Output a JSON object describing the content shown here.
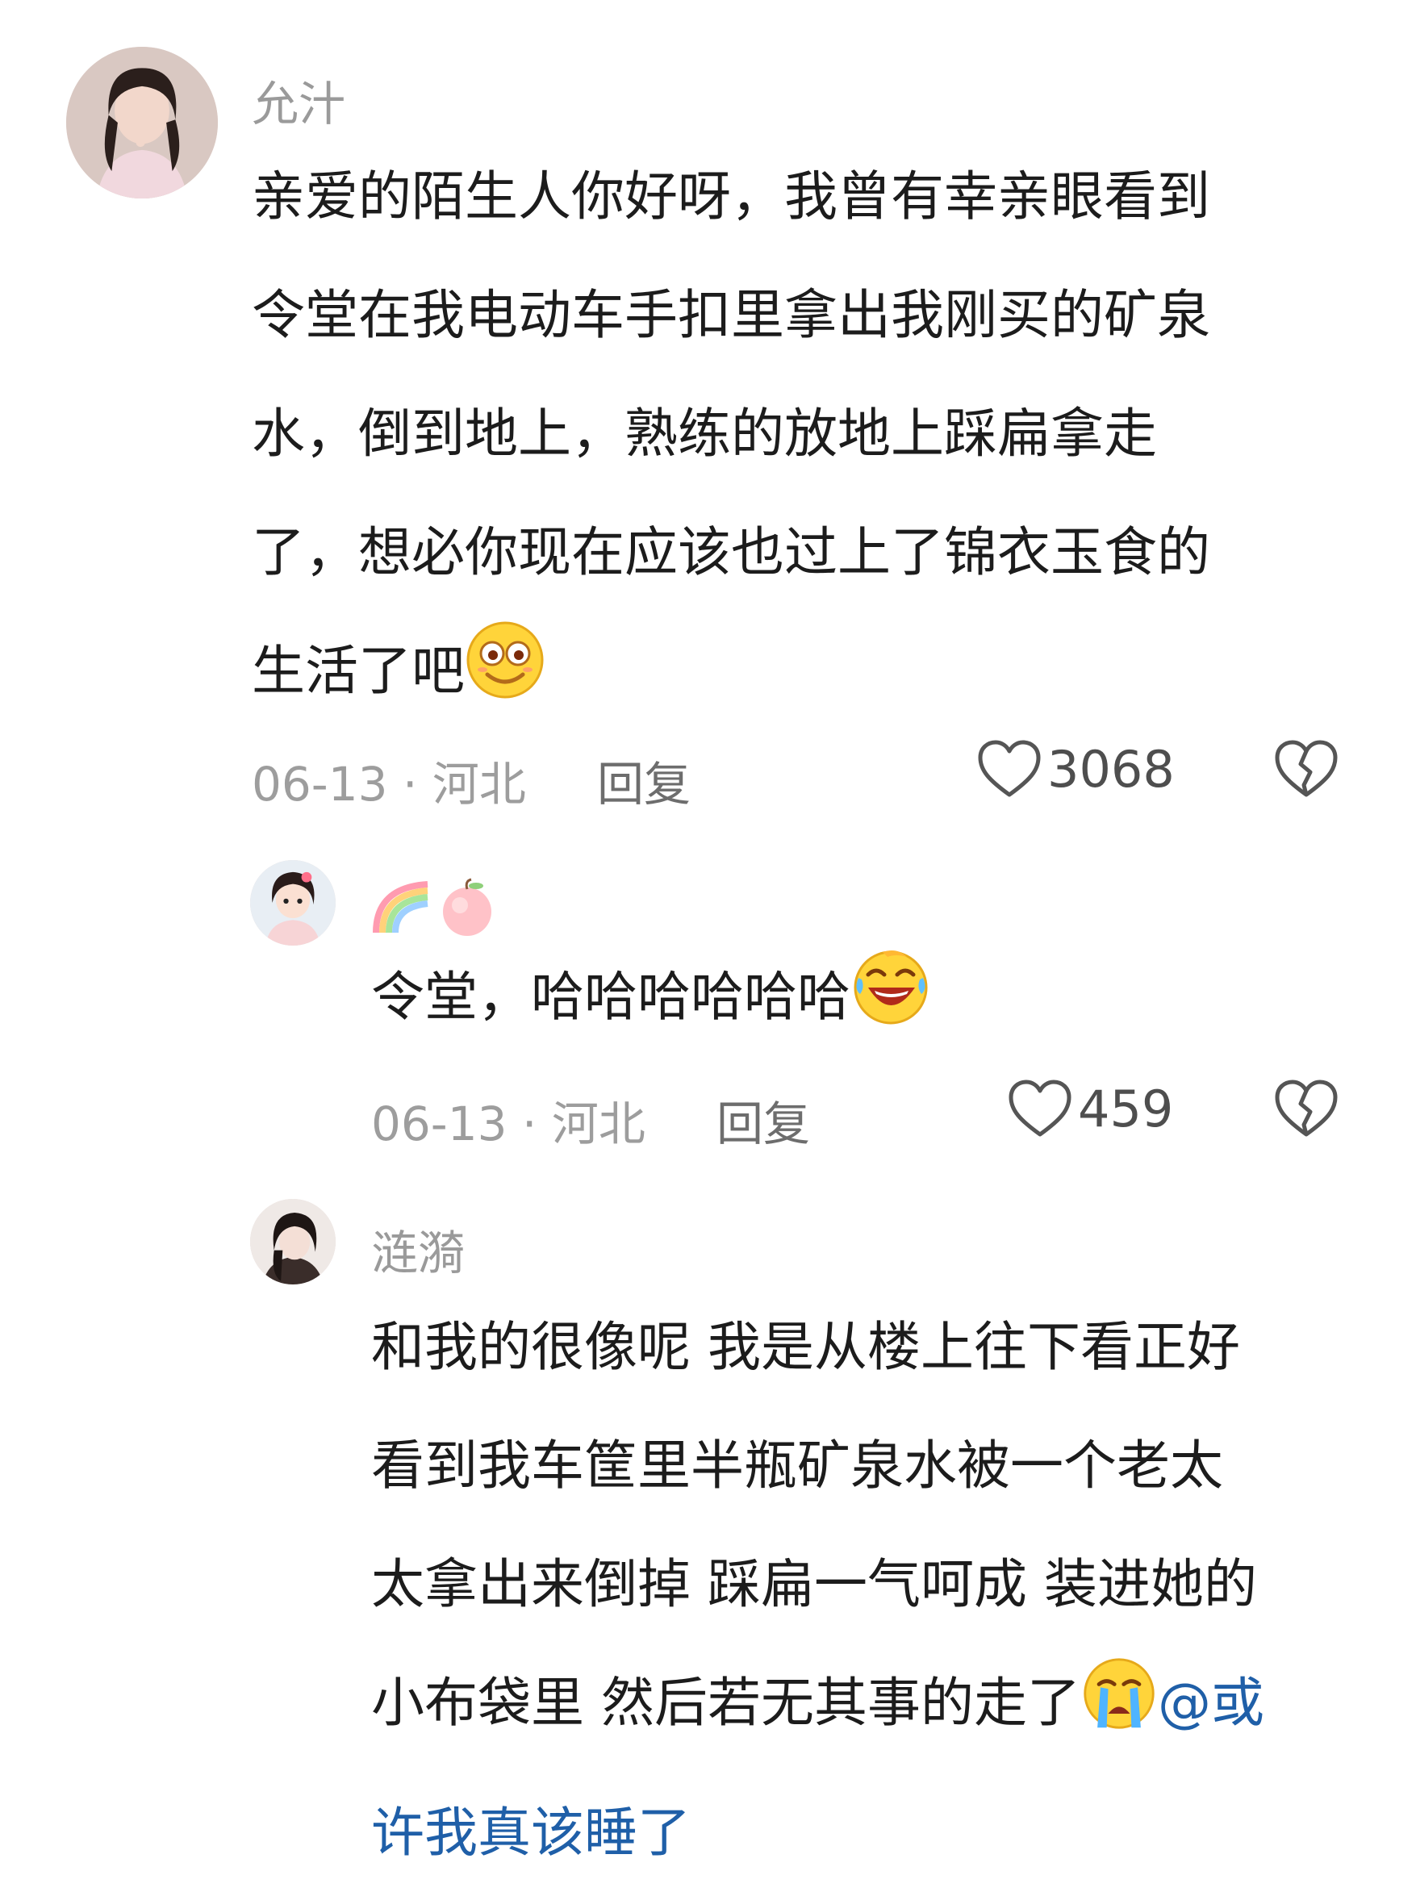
{
  "comments": [
    {
      "username": "允汁",
      "text": "亲爱的陌生人你好呀，我曾有幸亲眼看到令堂在我电动车手扣里拿出我刚买的矿泉水，倒到地上，熟练的放地上踩扁拿走了，想必你现在应该也过上了锦衣玉食的生活了吧",
      "lines": [
        "亲爱的陌生人你好呀，我曾有幸亲眼看到",
        "令堂在我电动车手扣里拿出我刚买的矿泉",
        "水，倒到地上，熟练的放地上踩扁拿走",
        "了，想必你现在应该也过上了锦衣玉食的",
        "生活了吧"
      ],
      "emoji": "smiling-face-emoji",
      "date": "06-13",
      "location": "河北",
      "meta": "06-13 · 河北",
      "reply_label": "回复",
      "likes": "3068"
    },
    {
      "username_emojis": [
        "rainbow-emoji",
        "peach-emoji"
      ],
      "text": "令堂，哈哈哈哈哈哈",
      "emoji": "rolling-laughing-emoji",
      "date": "06-13",
      "location": "河北",
      "meta": "06-13 · 河北",
      "reply_label": "回复",
      "likes": "459"
    },
    {
      "username": "涟漪",
      "lines": [
        "和我的很像呢 我是从楼上往下看正好",
        "看到我车筐里半瓶矿泉水被一个老太",
        "太拿出来倒掉 踩扁一气呵成 装进她的",
        "小布袋里 然后若无其事的走了"
      ],
      "emoji": "crying-face-emoji",
      "mention_part1": "@或",
      "mention_part2": "许我真该睡了"
    }
  ],
  "colors": {
    "username": "#9a9a9a",
    "body": "#1c1c1c",
    "meta": "#9d9d9d",
    "mention": "#1f5fa8"
  }
}
